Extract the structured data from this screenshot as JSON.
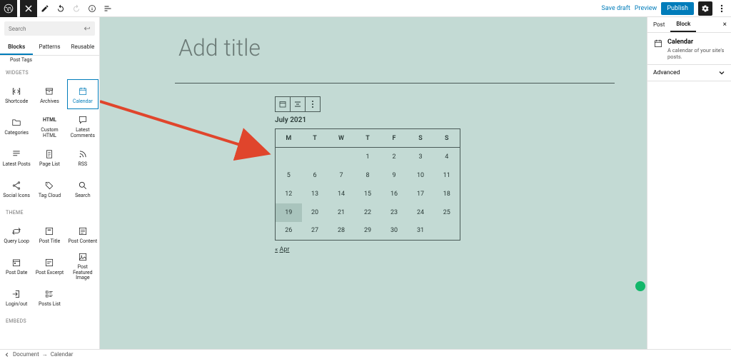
{
  "topbar": {
    "save_draft": "Save draft",
    "preview": "Preview",
    "publish": "Publish"
  },
  "search": {
    "placeholder": "Search"
  },
  "left_tabs": {
    "blocks": "Blocks",
    "patterns": "Patterns",
    "reusable": "Reusable"
  },
  "truncated_row": "Post Tags",
  "cat_widgets": "WIDGETS",
  "cat_theme": "THEME",
  "cat_embeds": "EMBEDS",
  "widgets": {
    "shortcode": "Shortcode",
    "archives": "Archives",
    "calendar": "Calendar",
    "categories": "Categories",
    "custom_html": "Custom\nHTML",
    "latest_comments": "Latest\nComments",
    "latest_posts": "Latest Posts",
    "page_list": "Page List",
    "rss": "RSS",
    "social_icons": "Social Icons",
    "tag_cloud": "Tag Cloud",
    "search_block": "Search"
  },
  "theme_blocks": {
    "query_loop": "Query Loop",
    "post_title": "Post Title",
    "post_content": "Post Content",
    "post_date": "Post Date",
    "post_excerpt": "Post Excerpt",
    "post_featured_image": "Post\nFeatured\nImage",
    "loginout": "Login/out",
    "posts_list": "Posts List"
  },
  "editor": {
    "title_placeholder": "Add title",
    "cal_caption": "July 2021",
    "dow": [
      "M",
      "T",
      "W",
      "T",
      "F",
      "S",
      "S"
    ],
    "weeks": [
      [
        "",
        "",
        "",
        "1",
        "2",
        "3",
        "4"
      ],
      [
        "5",
        "6",
        "7",
        "8",
        "9",
        "10",
        "11"
      ],
      [
        "12",
        "13",
        "14",
        "15",
        "16",
        "17",
        "18"
      ],
      [
        "19",
        "20",
        "21",
        "22",
        "23",
        "24",
        "25"
      ],
      [
        "26",
        "27",
        "28",
        "29",
        "30",
        "31",
        ""
      ]
    ],
    "today": "19",
    "prev_arrow": "«",
    "prev_month": "Apr"
  },
  "right": {
    "tab_post": "Post",
    "tab_block": "Block",
    "block_title": "Calendar",
    "block_desc": "A calendar of your site's posts.",
    "advanced": "Advanced"
  },
  "crumb": {
    "doc": "Document",
    "sep": "→",
    "leaf": "Calendar"
  }
}
